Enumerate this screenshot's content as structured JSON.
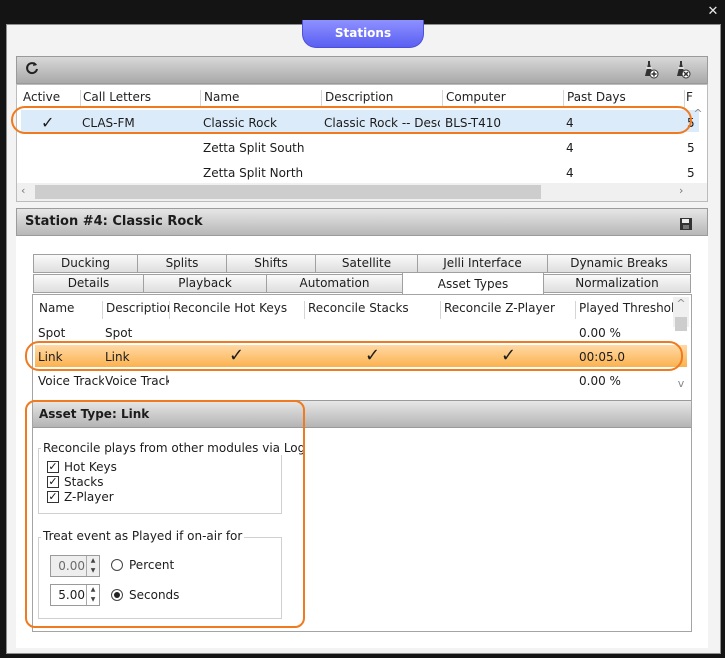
{
  "window": {
    "title": "Stations",
    "close_glyph": "✕"
  },
  "toolbar": {
    "refresh_icon": "refresh-icon",
    "add_station_icon": "add-station-icon",
    "remove_station_icon": "remove-station-icon"
  },
  "stations_grid": {
    "columns": [
      "Active",
      "Call Letters",
      "Name",
      "Description",
      "Computer",
      "Past Days",
      "F"
    ],
    "rows": [
      {
        "active": "✓",
        "call_letters": "CLAS-FM",
        "name": "Classic Rock",
        "description": "Classic Rock -- Descrip",
        "computer": "BLS-T410",
        "past_days": "4",
        "f": "5"
      },
      {
        "active": "",
        "call_letters": "",
        "name": "Zetta Split South",
        "description": "",
        "computer": "",
        "past_days": "4",
        "f": "5"
      },
      {
        "active": "",
        "call_letters": "",
        "name": "Zetta Split North",
        "description": "",
        "computer": "",
        "past_days": "4",
        "f": "5"
      }
    ],
    "selected_row": 0
  },
  "detail": {
    "title": "Station #4: Classic Rock",
    "save_icon": "save-icon"
  },
  "tabs": {
    "row1": [
      "Ducking",
      "Splits",
      "Shifts",
      "Satellite",
      "Jelli Interface",
      "Dynamic Breaks"
    ],
    "row2": [
      "Details",
      "Playback",
      "Automation",
      "Asset Types",
      "Normalization"
    ],
    "active": "Asset Types"
  },
  "asset_types_grid": {
    "columns": [
      "Name",
      "Description",
      "Reconcile Hot Keys",
      "Reconcile Stacks",
      "Reconcile Z-Player",
      "Played Threshold"
    ],
    "rows": [
      {
        "name": "Spot",
        "description": "Spot",
        "hot_keys": "",
        "stacks": "",
        "zplayer": "",
        "threshold": "0.00 %"
      },
      {
        "name": "Link",
        "description": "Link",
        "hot_keys": "✓",
        "stacks": "✓",
        "zplayer": "✓",
        "threshold": "00:05.0"
      },
      {
        "name": "Voice Track",
        "description": "Voice Track",
        "hot_keys": "",
        "stacks": "",
        "zplayer": "",
        "threshold": "0.00 %"
      }
    ],
    "selected_row": 1
  },
  "asset_type_detail": {
    "header_label": "Asset Type:",
    "header_value": "Link",
    "reconcile_group": {
      "title": "Reconcile plays from other modules via Log",
      "options": [
        {
          "label": "Hot Keys",
          "checked": true
        },
        {
          "label": "Stacks",
          "checked": true
        },
        {
          "label": "Z-Player",
          "checked": true
        }
      ]
    },
    "played_group": {
      "title": "Treat event as Played if on-air for",
      "percent_value": "0.00",
      "percent_label": "Percent",
      "seconds_value": "5.00",
      "seconds_label": "Seconds",
      "selected": "Seconds"
    }
  },
  "colors": {
    "highlight_outline": "#ef7a1f",
    "title_tab": "#6b6ff5",
    "selected_row": "#fbb24f"
  }
}
